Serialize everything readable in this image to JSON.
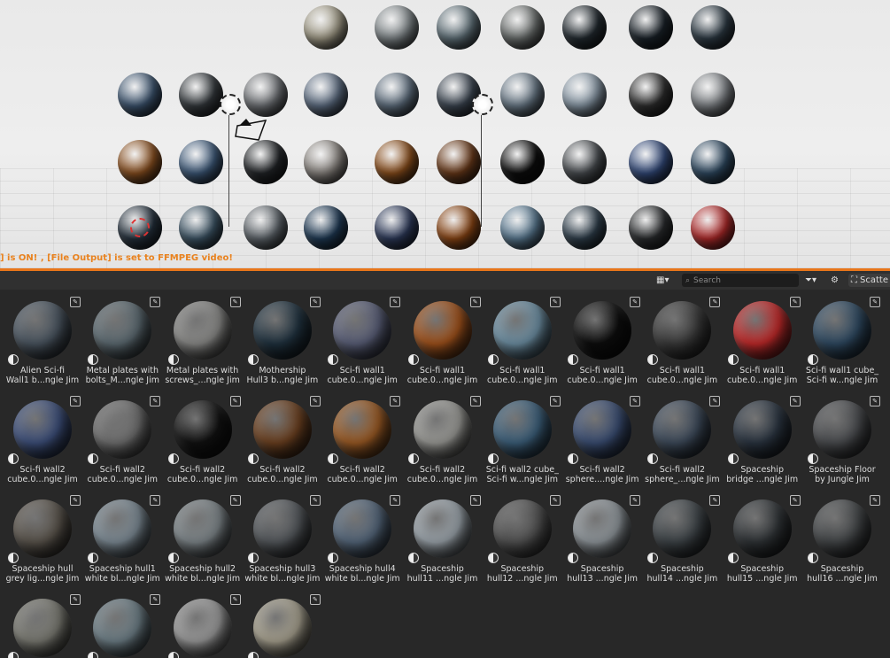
{
  "viewport": {
    "status_text": "] is ON! , [File Output] is set to FFMPEG video!"
  },
  "header": {
    "search_placeholder": "Search",
    "scatter_label": "Scatte",
    "display_mode_icon": "grid-view-icon",
    "filter_icon": "filter-icon",
    "settings_icon": "gear-icon",
    "scatter_icon": "scatter-icon"
  },
  "assets": [
    {
      "line1": "Alien Sci-fi",
      "line2": "Wall1 b...ngle Jim",
      "color": "#4a5560"
    },
    {
      "line1": "Metal plates with",
      "line2": "bolts_M...ngle Jim",
      "color": "#5d6b72"
    },
    {
      "line1": "Metal plates with",
      "line2": "screws_...ngle Jim",
      "color": "#8a8a88"
    },
    {
      "line1": "Mothership",
      "line2": "Hull3 b...ngle Jim",
      "color": "#20323f"
    },
    {
      "line1": "Sci-fi wall1",
      "line2": "cube.0...ngle Jim",
      "color": "#5a5f78"
    },
    {
      "line1": "Sci-fi wall1",
      "line2": "cube.0...ngle Jim",
      "color": "#a0521c"
    },
    {
      "line1": "Sci-fi wall1",
      "line2": "cube.0...ngle Jim",
      "color": "#6d8fa3"
    },
    {
      "line1": "Sci-fi wall1",
      "line2": "cube.0...ngle Jim",
      "color": "#0d0d0d"
    },
    {
      "line1": "Sci-fi wall1",
      "line2": "cube.0...ngle Jim",
      "color": "#3a3a3a"
    },
    {
      "line1": "Sci-fi wall1",
      "line2": "cube.0...ngle Jim",
      "color": "#c12a2a"
    },
    {
      "line1": "Sci-fi wall1 cube_",
      "line2": "Sci-fi w...ngle Jim",
      "color": "#2f4a62"
    },
    {
      "line1": "Sci-fi wall2",
      "line2": "cube.0...ngle Jim",
      "color": "#3d4f7a"
    },
    {
      "line1": "Sci-fi wall2",
      "line2": "cube.0...ngle Jim",
      "color": "#707070"
    },
    {
      "line1": "Sci-fi wall2",
      "line2": "cube.0...ngle Jim",
      "color": "#111111"
    },
    {
      "line1": "Sci-fi wall2",
      "line2": "cube.0...ngle Jim",
      "color": "#6b4020"
    },
    {
      "line1": "Sci-fi wall2",
      "line2": "cube.0...ngle Jim",
      "color": "#9a5a24"
    },
    {
      "line1": "Sci-fi wall2",
      "line2": "cube.0...ngle Jim",
      "color": "#9a9a96"
    },
    {
      "line1": "Sci-fi wall2 cube_",
      "line2": "Sci-fi w...ngle Jim",
      "color": "#3c5f7a"
    },
    {
      "line1": "Sci-fi wall2",
      "line2": "sphere....ngle Jim",
      "color": "#3a4d72"
    },
    {
      "line1": "Sci-fi wall2",
      "line2": "sphere_...ngle Jim",
      "color": "#3d4a5a"
    },
    {
      "line1": "Spaceship",
      "line2": "bridge ...ngle Jim",
      "color": "#2a3440"
    },
    {
      "line1": "Spaceship Floor",
      "line2": "by Jungle Jim",
      "color": "#4a4c4f"
    },
    {
      "line1": "Spaceship hull",
      "line2": "grey lig...ngle Jim",
      "color": "#5a544c"
    },
    {
      "line1": "Spaceship hull1",
      "line2": "white bl...ngle Jim",
      "color": "#7c8a94"
    },
    {
      "line1": "Spaceship hull2",
      "line2": "white bl...ngle Jim",
      "color": "#7d8589"
    },
    {
      "line1": "Spaceship hull3",
      "line2": "white bl...ngle Jim",
      "color": "#54585c"
    },
    {
      "line1": "Spaceship hull4",
      "line2": "white bl...ngle Jim",
      "color": "#54667a"
    },
    {
      "line1": "Spaceship",
      "line2": "hull11 ...ngle Jim",
      "color": "#9aa3aa"
    },
    {
      "line1": "Spaceship",
      "line2": "hull12 ...ngle Jim",
      "color": "#525252"
    },
    {
      "line1": "Spaceship",
      "line2": "hull13 ...ngle Jim",
      "color": "#8f969b"
    },
    {
      "line1": "Spaceship",
      "line2": "hull14 ...ngle Jim",
      "color": "#3d4347"
    },
    {
      "line1": "Spaceship",
      "line2": "hull15 ...ngle Jim",
      "color": "#2f3336"
    },
    {
      "line1": "Spaceship",
      "line2": "hull16 ...ngle Jim",
      "color": "#434648"
    },
    {
      "line1": "",
      "line2": "",
      "color": "#7a7a72"
    },
    {
      "line1": "",
      "line2": "",
      "color": "#6d7e86"
    },
    {
      "line1": "",
      "line2": "",
      "color": "#9a9a9a"
    },
    {
      "line1": "",
      "line2": "",
      "color": "#a6a08e"
    }
  ],
  "viewport_spheres": [
    {
      "color": "#a09a86"
    },
    {
      "color": "#7e8588"
    },
    {
      "color": "#5f7078"
    },
    {
      "color": "#6b6f6e"
    },
    {
      "color": "#222a30"
    },
    {
      "color": "#1a2229"
    },
    {
      "color": "#2d3a44"
    },
    {
      "color": "#3d5570"
    },
    {
      "color": "#353a3e"
    },
    {
      "color": "#6f7276"
    },
    {
      "color": "#5d6d82"
    },
    {
      "color": "#5f6f7f"
    },
    {
      "color": "#3c4652"
    },
    {
      "color": "#6a7a88"
    },
    {
      "color": "#8696a4"
    },
    {
      "color": "#2e2e2e"
    },
    {
      "color": "#7d8185"
    },
    {
      "color": "#8a5020"
    },
    {
      "color": "#3e5a7a"
    },
    {
      "color": "#222528"
    },
    {
      "color": "#8a8580"
    },
    {
      "color": "#8a4e1c"
    },
    {
      "color": "#6a3a1a"
    },
    {
      "color": "#0d0d0d"
    },
    {
      "color": "#4a4e52"
    },
    {
      "color": "#334a7a"
    },
    {
      "color": "#2f4a62"
    },
    {
      "color": "#24303c"
    },
    {
      "color": "#3d5566"
    },
    {
      "color": "#5f666c"
    },
    {
      "color": "#1f3a55"
    },
    {
      "color": "#2d3a5a"
    },
    {
      "color": "#8a4514"
    },
    {
      "color": "#5a7a92"
    },
    {
      "color": "#2f3f4c"
    },
    {
      "color": "#2a2c2e"
    },
    {
      "color": "#b02a2a"
    }
  ]
}
